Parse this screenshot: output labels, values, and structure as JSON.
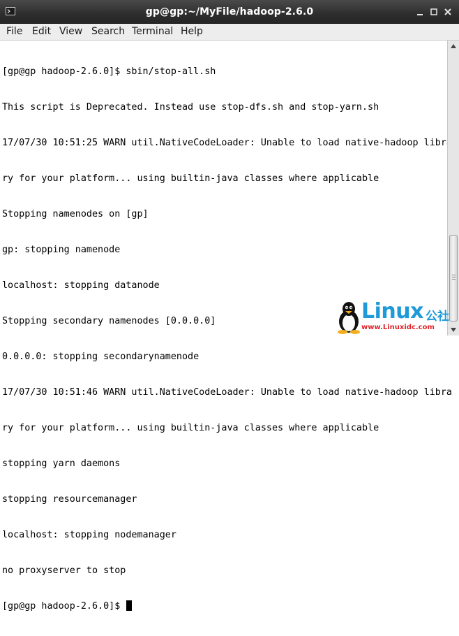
{
  "window": {
    "title": "gp@gp:~/MyFile/hadoop-2.6.0",
    "icon": "terminal-icon",
    "buttons": [
      "minimize-icon",
      "maximize-icon",
      "close-icon"
    ]
  },
  "menubar": {
    "items": [
      "File",
      "Edit",
      "View",
      "Search",
      "Terminal",
      "Help"
    ]
  },
  "terminal": {
    "lines": [
      "[gp@gp hadoop-2.6.0]$ sbin/stop-all.sh",
      "This script is Deprecated. Instead use stop-dfs.sh and stop-yarn.sh",
      "17/07/30 10:51:25 WARN util.NativeCodeLoader: Unable to load native-hadoop libra",
      "ry for your platform... using builtin-java classes where applicable",
      "Stopping namenodes on [gp]",
      "gp: stopping namenode",
      "localhost: stopping datanode",
      "Stopping secondary namenodes [0.0.0.0]",
      "0.0.0.0: stopping secondarynamenode",
      "17/07/30 10:51:46 WARN util.NativeCodeLoader: Unable to load native-hadoop libra",
      "ry for your platform... using builtin-java classes where applicable",
      "stopping yarn daemons",
      "stopping resourcemanager",
      "localhost: stopping nodemanager",
      "no proxyserver to stop"
    ],
    "prompt": "[gp@gp hadoop-2.6.0]$ "
  },
  "watermark": {
    "brand": "Linux",
    "brand_cn": "公社",
    "url": "www.Linuxidc.com",
    "icon": "penguin-logo-icon"
  },
  "colors": {
    "titlebar": "#2e2e2e",
    "menubar": "#ededed",
    "terminal_bg": "#ffffff",
    "watermark_blue": "#1e9ad8",
    "watermark_red": "#e0242a"
  }
}
